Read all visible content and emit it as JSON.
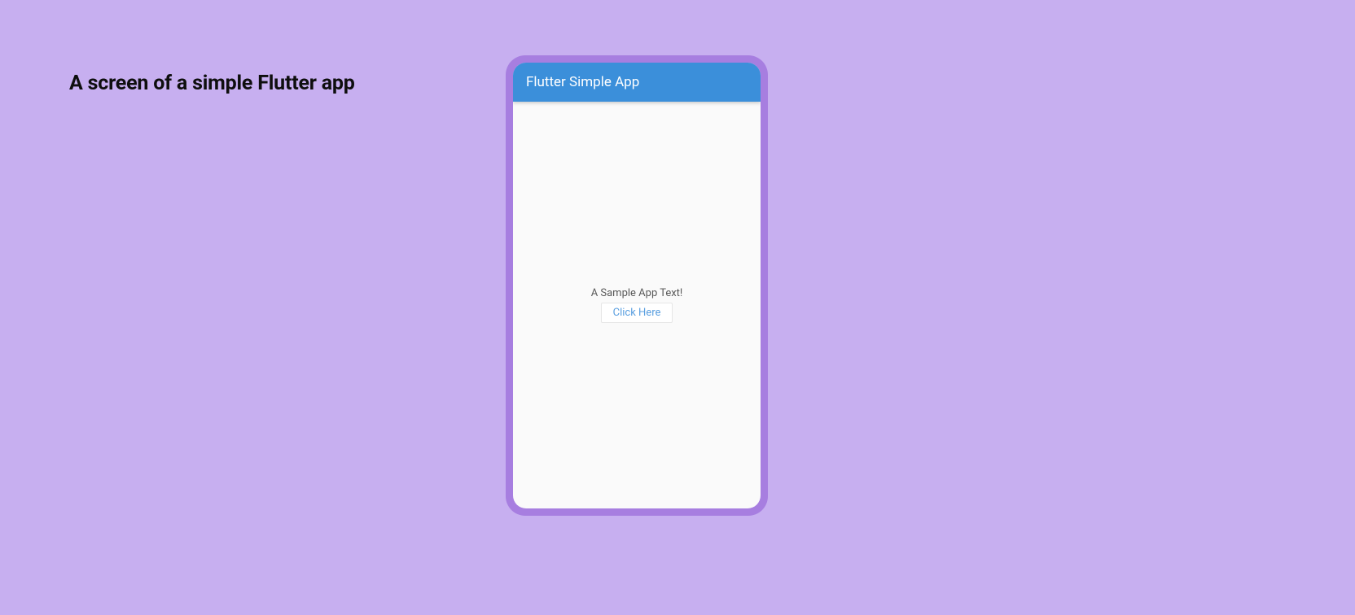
{
  "caption": "A screen of a simple Flutter app",
  "app": {
    "bar_title": "Flutter Simple App",
    "body_text": "A Sample App Text!",
    "button_label": "Click Here"
  }
}
